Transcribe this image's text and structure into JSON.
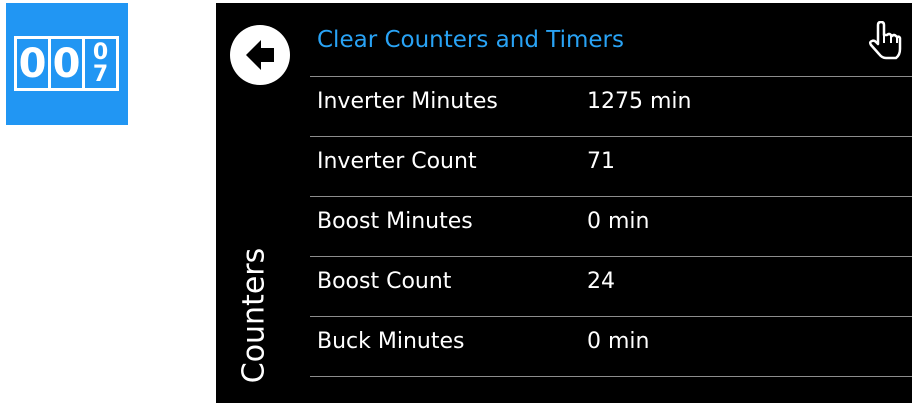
{
  "app_icon": {
    "name": "counter-icon",
    "digits": [
      "0",
      "0"
    ],
    "rolling_digit_top": "0",
    "rolling_digit_bottom": "7",
    "color": "#2196f3"
  },
  "header": {
    "title": "Clear Counters and Timers",
    "title_color": "#29a3f5",
    "back_icon": "back-arrow-icon",
    "touch_icon": "hand-pointer-icon"
  },
  "section_label": "Counters",
  "rows": [
    {
      "label": "Inverter Minutes",
      "value": "1275 min"
    },
    {
      "label": "Inverter Count",
      "value": "71"
    },
    {
      "label": "Boost Minutes",
      "value": "0 min"
    },
    {
      "label": "Boost Count",
      "value": "24"
    },
    {
      "label": "Buck Minutes",
      "value": "0 min"
    }
  ]
}
